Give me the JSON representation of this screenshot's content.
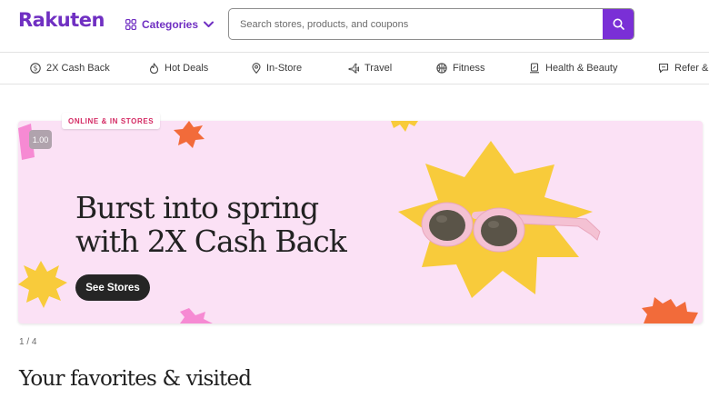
{
  "header": {
    "logo_text": "Rakuten",
    "categories_label": "Categories",
    "search": {
      "placeholder": "Search stores, products, and coupons"
    }
  },
  "nav": {
    "items": [
      {
        "label": "2X Cash Back",
        "icon": "dollar-circle-icon"
      },
      {
        "label": "Hot Deals",
        "icon": "flame-icon"
      },
      {
        "label": "In-Store",
        "icon": "location-pin-icon"
      },
      {
        "label": "Travel",
        "icon": "airplane-icon"
      },
      {
        "label": "Fitness",
        "icon": "basketball-icon"
      },
      {
        "label": "Health & Beauty",
        "icon": "mirror-icon"
      },
      {
        "label": "Refer & E",
        "icon": "chat-icon"
      }
    ]
  },
  "banner": {
    "badge": "ONLINE & IN STORES",
    "timer": "1.00",
    "headline_line1": "Burst into spring",
    "headline_line2": "with 2X Cash Back",
    "cta": "See Stores",
    "colors": {
      "background": "#fbe1f5",
      "burst_yellow": "#f8cb3b",
      "burst_orange": "#f26b3a",
      "burst_pink": "#f68ad3"
    }
  },
  "carousel": {
    "page_indicator": "1 / 4"
  },
  "favorites": {
    "title": "Your favorites & visited"
  },
  "colors": {
    "brand_purple": "#7030c2",
    "search_button": "#7a2fd6"
  }
}
